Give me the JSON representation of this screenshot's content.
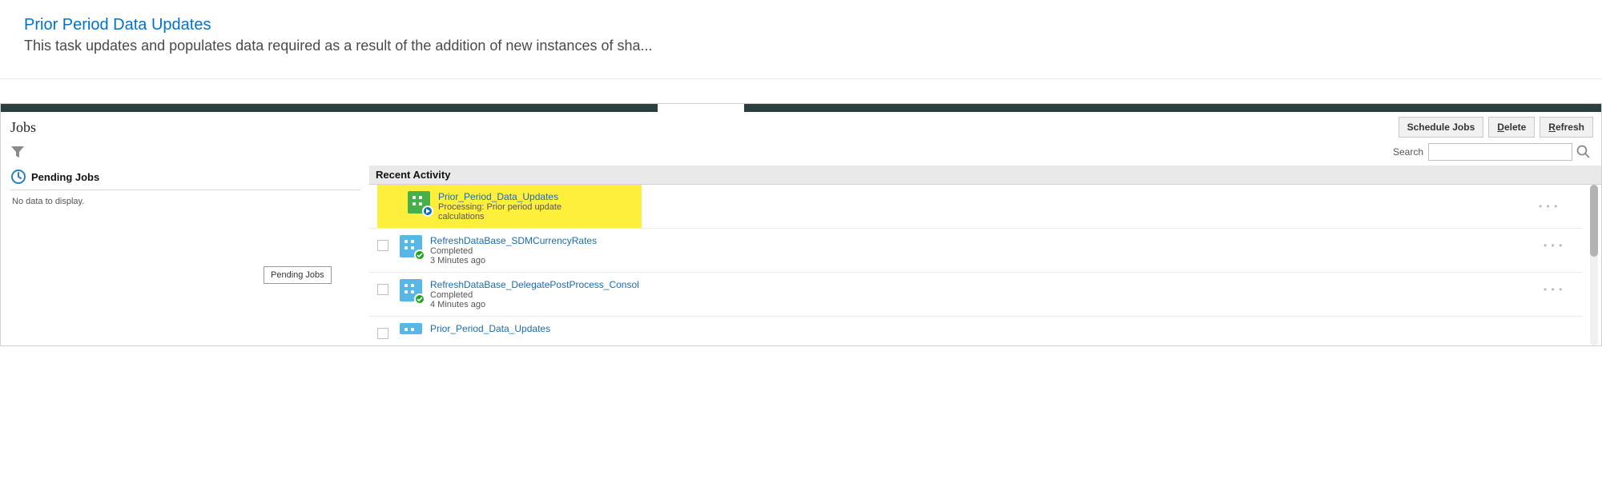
{
  "top": {
    "link_text": "Prior Period Data Updates",
    "description": "This task updates and populates data required as a result of the addition of new instances of sha..."
  },
  "jobs": {
    "title": "Jobs",
    "buttons": {
      "schedule": "Schedule Jobs",
      "delete_prefix": "D",
      "delete_rest": "elete",
      "refresh_prefix": "R",
      "refresh_rest": "efresh"
    },
    "search_label": "Search",
    "search_placeholder": ""
  },
  "pending": {
    "heading": "Pending Jobs",
    "empty": "No data to display.",
    "tooltip": "Pending Jobs"
  },
  "recent": {
    "heading": "Recent Activity",
    "rows": [
      {
        "name": "Prior_Period_Data_Updates",
        "status": "Processing: Prior period update calculations",
        "time": "",
        "icon": "green",
        "badge": "play",
        "highlight": true
      },
      {
        "name": "RefreshDataBase_SDMCurrencyRates",
        "status": "Completed",
        "time": "3 Minutes ago",
        "icon": "blue",
        "badge": "check",
        "highlight": false
      },
      {
        "name": "RefreshDataBase_DelegatePostProcess_Consol",
        "status": "Completed",
        "time": "4 Minutes ago",
        "icon": "blue",
        "badge": "check",
        "highlight": false
      },
      {
        "name": "Prior_Period_Data_Updates",
        "status": "",
        "time": "",
        "icon": "blue",
        "badge": "none",
        "highlight": false
      }
    ],
    "menu_glyph": "• • •"
  }
}
